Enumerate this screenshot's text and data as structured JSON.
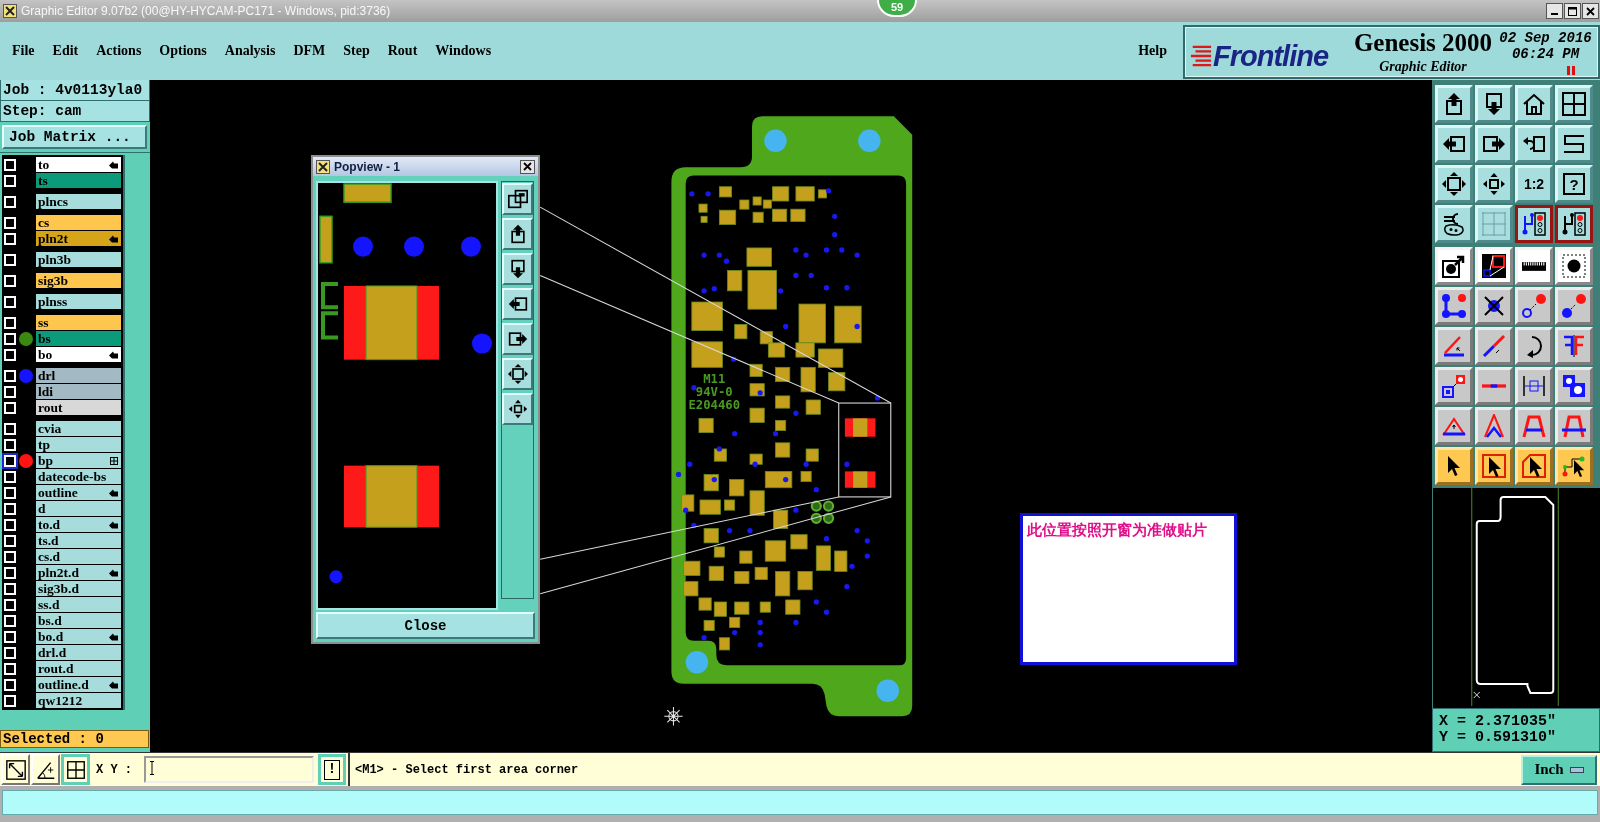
{
  "window": {
    "title": "Graphic Editor 9.07b2 (00@HY-HYCAM-PC171 - Windows, pid:3736)"
  },
  "badge": {
    "count": "59"
  },
  "menu": {
    "items": [
      "File",
      "Edit",
      "Actions",
      "Options",
      "Analysis",
      "DFM",
      "Step",
      "Rout",
      "Windows"
    ],
    "help": "Help"
  },
  "brand": {
    "logo": "Frontline",
    "product": "Genesis 2000",
    "subtitle": "Graphic Editor",
    "date": "02 Sep 2016",
    "time": "06:24 PM"
  },
  "job_panel": {
    "job": "Job : 4v0113yla0",
    "step": "Step: cam",
    "matrix_button": "Job Matrix ...",
    "layer_groups": [
      {
        "layers": [
          {
            "name": "to",
            "color": "#ffffff",
            "checked": false,
            "highlighted": false,
            "marked": true
          },
          {
            "name": "ts",
            "color": "#0b9b7b",
            "checked": false,
            "highlighted": false,
            "marked": false
          }
        ]
      },
      {
        "layers": [
          {
            "name": "plncs",
            "color": "#a6dcdc",
            "checked": false,
            "highlighted": false,
            "marked": false
          }
        ]
      },
      {
        "layers": [
          {
            "name": "cs",
            "color": "#ffc64e",
            "checked": false,
            "highlighted": false,
            "marked": false
          },
          {
            "name": "pln2t",
            "color": "#d6a418",
            "checked": false,
            "highlighted": false,
            "marked": true
          }
        ]
      },
      {
        "layers": [
          {
            "name": "pln3b",
            "color": "#a6dcdc",
            "checked": false,
            "highlighted": false,
            "marked": false
          }
        ]
      },
      {
        "layers": [
          {
            "name": "sig3b",
            "color": "#ffc64e",
            "checked": false,
            "highlighted": false,
            "marked": false
          }
        ]
      },
      {
        "layers": [
          {
            "name": "plnss",
            "color": "#a6dcdc",
            "checked": false,
            "highlighted": false,
            "marked": false
          }
        ]
      },
      {
        "layers": [
          {
            "name": "ss",
            "color": "#ffc64e",
            "checked": false,
            "highlighted": false,
            "marked": false
          },
          {
            "name": "bs",
            "color": "#0b9b7b",
            "dot": {
              "color": "#3a8a12"
            },
            "checked": false,
            "highlighted": false,
            "marked": false
          },
          {
            "name": "bo",
            "color": "#ffffff",
            "checked": false,
            "highlighted": false,
            "marked": true
          }
        ]
      },
      {
        "layers": [
          {
            "name": "drl",
            "color": "#a3b9c3",
            "dot": {
              "color": "#1414ff"
            },
            "checked": false,
            "highlighted": false,
            "marked": false
          },
          {
            "name": "ldi",
            "color": "#a3b9c3",
            "checked": false,
            "highlighted": false,
            "marked": false
          },
          {
            "name": "rout",
            "color": "#d8d8d8",
            "checked": false,
            "highlighted": false,
            "marked": false
          }
        ]
      },
      {
        "layers": [
          {
            "name": "cvia",
            "color": "#a6dcdc",
            "checked": false,
            "highlighted": false,
            "marked": false
          },
          {
            "name": "tp",
            "color": "#a6dcdc",
            "checked": false,
            "highlighted": false,
            "marked": false
          },
          {
            "name": "bp",
            "color": "#a6dcdc",
            "dot": {
              "color": "#ff1414"
            },
            "checked": false,
            "highlighted": true,
            "marked": false
          },
          {
            "name": "datecode-bs",
            "color": "#a6dcdc",
            "checked": false,
            "highlighted": false,
            "marked": false
          },
          {
            "name": "outline",
            "color": "#a6dcdc",
            "checked": false,
            "highlighted": false,
            "marked": true
          },
          {
            "name": "d",
            "color": "#a6dcdc",
            "checked": false,
            "highlighted": false,
            "marked": false
          },
          {
            "name": "to.d",
            "color": "#a6dcdc",
            "checked": false,
            "highlighted": false,
            "marked": true
          },
          {
            "name": "ts.d",
            "color": "#a6dcdc",
            "checked": false,
            "highlighted": false,
            "marked": false
          },
          {
            "name": "cs.d",
            "color": "#a6dcdc",
            "checked": false,
            "highlighted": false,
            "marked": false
          },
          {
            "name": "pln2t.d",
            "color": "#a6dcdc",
            "checked": false,
            "highlighted": false,
            "marked": true
          },
          {
            "name": "sig3b.d",
            "color": "#a6dcdc",
            "checked": false,
            "highlighted": false,
            "marked": false
          },
          {
            "name": "ss.d",
            "color": "#a6dcdc",
            "checked": false,
            "highlighted": false,
            "marked": false
          },
          {
            "name": "bs.d",
            "color": "#a6dcdc",
            "checked": false,
            "highlighted": false,
            "marked": false
          },
          {
            "name": "bo.d",
            "color": "#a6dcdc",
            "checked": false,
            "highlighted": false,
            "marked": true
          },
          {
            "name": "drl.d",
            "color": "#a6dcdc",
            "checked": false,
            "highlighted": false,
            "marked": false
          },
          {
            "name": "rout.d",
            "color": "#a6dcdc",
            "checked": false,
            "highlighted": false,
            "marked": false
          },
          {
            "name": "outline.d",
            "color": "#a6dcdc",
            "checked": false,
            "highlighted": false,
            "marked": true
          },
          {
            "name": "qw1212",
            "color": "#a6dcdc",
            "checked": false,
            "highlighted": false,
            "marked": false
          }
        ]
      }
    ],
    "selected": "Selected : 0"
  },
  "board": {
    "markings": [
      "M11",
      "94V-0",
      "E204460"
    ]
  },
  "popview": {
    "title": "Popview - 1",
    "close_button": "Close"
  },
  "note": {
    "text": "此位置按照开窗为准做贴片"
  },
  "toolbar": [
    {
      "kind": "view",
      "pressed": false
    },
    {
      "kind": "view",
      "pressed": false
    },
    {
      "kind": "view",
      "pressed": false
    },
    {
      "kind": "view",
      "pressed": false
    },
    {
      "kind": "view",
      "pressed": false
    },
    {
      "kind": "view",
      "pressed": false
    },
    {
      "kind": "view",
      "pressed": false
    },
    {
      "kind": "view",
      "pressed": false
    },
    {
      "kind": "view",
      "pressed": false
    },
    {
      "kind": "view",
      "pressed": false
    },
    {
      "kind": "view",
      "pressed": false,
      "label": "1:2"
    },
    {
      "kind": "view",
      "pressed": false,
      "label": "?"
    },
    {
      "kind": "view",
      "pressed": false
    },
    {
      "kind": "view",
      "pressed": false
    },
    {
      "kind": "view",
      "pressed": true
    },
    {
      "kind": "view",
      "pressed": true
    },
    {
      "kind": "display",
      "pressed": false
    },
    {
      "kind": "display",
      "pressed": false
    },
    {
      "kind": "display",
      "pressed": false
    },
    {
      "kind": "display",
      "pressed": false
    },
    {
      "kind": "edit",
      "pressed": false
    },
    {
      "kind": "edit",
      "pressed": false
    },
    {
      "kind": "edit",
      "pressed": false
    },
    {
      "kind": "edit",
      "pressed": false
    },
    {
      "kind": "edit",
      "pressed": false
    },
    {
      "kind": "edit",
      "pressed": false
    },
    {
      "kind": "edit",
      "pressed": false
    },
    {
      "kind": "edit",
      "pressed": false
    },
    {
      "kind": "edit",
      "pressed": false
    },
    {
      "kind": "edit",
      "pressed": false
    },
    {
      "kind": "edit",
      "pressed": false
    },
    {
      "kind": "edit",
      "pressed": false
    },
    {
      "kind": "edit",
      "pressed": false
    },
    {
      "kind": "edit",
      "pressed": false
    },
    {
      "kind": "edit",
      "pressed": false
    },
    {
      "kind": "edit",
      "pressed": false
    },
    {
      "kind": "select",
      "pressed": false
    },
    {
      "kind": "select",
      "pressed": false
    },
    {
      "kind": "select",
      "pressed": false
    },
    {
      "kind": "select",
      "pressed": false
    }
  ],
  "coordinates": {
    "x": "X = 2.371035\"",
    "y": "Y = 0.591310\""
  },
  "command_bar": {
    "label": "X Y :",
    "confirm_button": "!",
    "message": "<M1> - Select first area corner",
    "units": "Inch"
  }
}
